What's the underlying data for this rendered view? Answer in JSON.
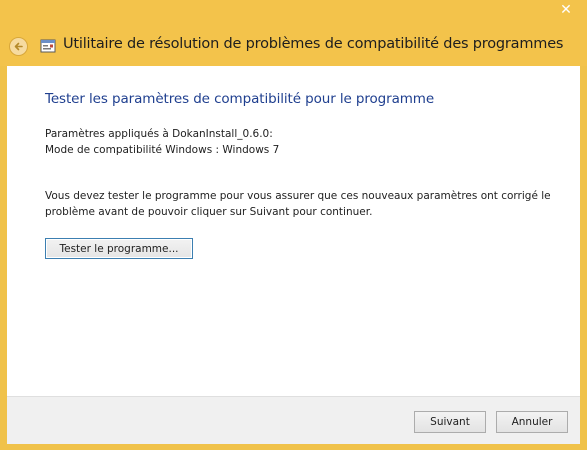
{
  "window": {
    "title": "Utilitaire de résolution de problèmes de compatibilité des programmes",
    "close_glyph": "✕",
    "frame_color": "#f3c34b",
    "heading_color": "#1f3f8f"
  },
  "content": {
    "heading": "Tester les paramètres de compatibilité pour le programme",
    "settings_applied_line": "Paramètres appliqués à  DokanInstall_0.6.0:",
    "compat_mode_line": "Mode de compatibilité Windows : Windows 7",
    "instructions": "Vous devez tester le programme pour vous assurer que ces nouveaux paramètres ont corrigé le problème avant de pouvoir cliquer sur Suivant pour continuer.",
    "test_button_label": "Tester le programme..."
  },
  "footer": {
    "next_label": "Suivant",
    "cancel_label": "Annuler"
  },
  "icons": {
    "back": "back-arrow-icon",
    "app": "troubleshooter-icon",
    "close": "close-icon"
  }
}
